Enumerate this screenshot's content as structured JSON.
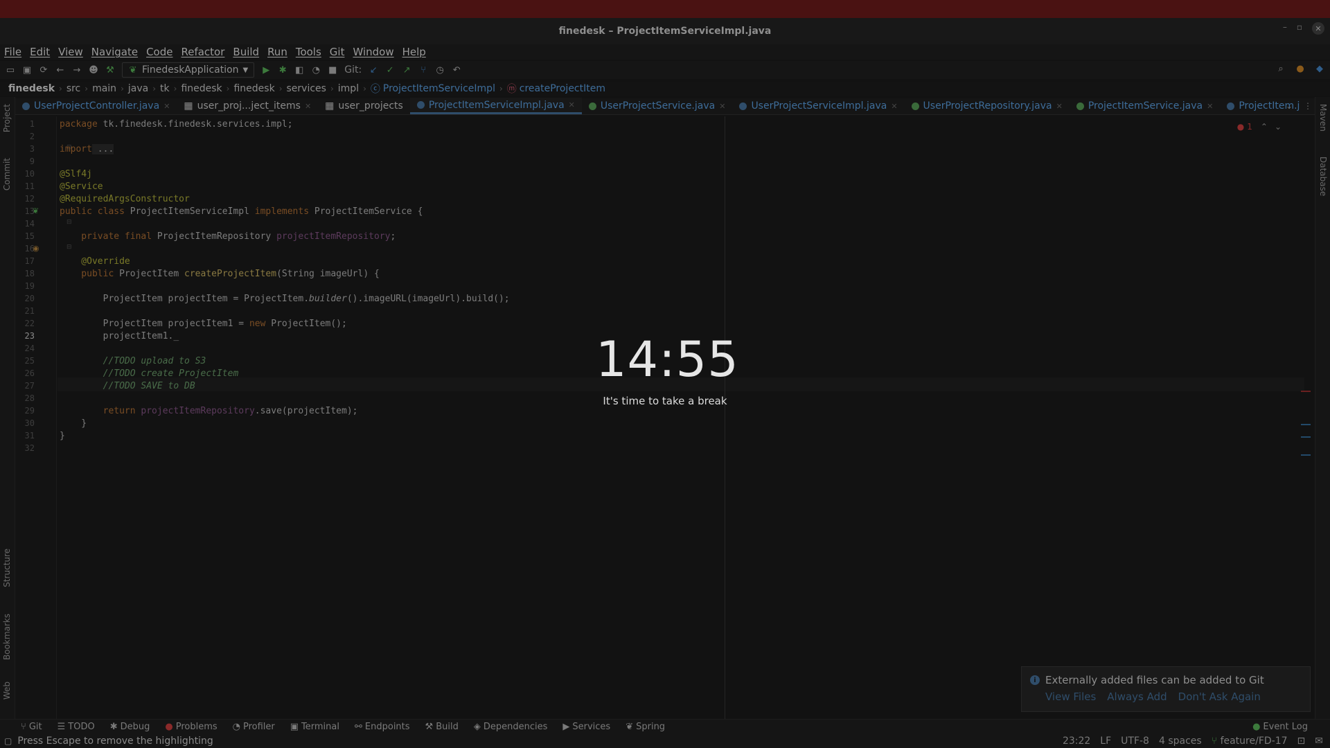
{
  "window": {
    "title": "finedesk – ProjectItemServiceImpl.java"
  },
  "menu": [
    "File",
    "Edit",
    "View",
    "Navigate",
    "Code",
    "Refactor",
    "Build",
    "Run",
    "Tools",
    "Git",
    "Window",
    "Help"
  ],
  "toolbar": {
    "run_config": "FinedeskApplication",
    "git_label": "Git:"
  },
  "breadcrumb": {
    "root": "finedesk",
    "items": [
      "src",
      "main",
      "java",
      "tk",
      "finedesk",
      "finedesk",
      "services",
      "impl"
    ],
    "class": "ProjectItemServiceImpl",
    "method": "createProjectItem"
  },
  "tabs": [
    {
      "label": "UserProjectController.java",
      "kind": "class"
    },
    {
      "label": "user_proj...ject_items",
      "kind": "table"
    },
    {
      "label": "user_projects",
      "kind": "table"
    },
    {
      "label": "ProjectItemServiceImpl.java",
      "kind": "class",
      "active": true
    },
    {
      "label": "UserProjectService.java",
      "kind": "interface"
    },
    {
      "label": "UserProjectServiceImpl.java",
      "kind": "class"
    },
    {
      "label": "UserProjectRepository.java",
      "kind": "interface"
    },
    {
      "label": "ProjectItemService.java",
      "kind": "interface"
    },
    {
      "label": "ProjectItem.j",
      "kind": "class"
    }
  ],
  "side_tools": {
    "left": [
      "Project",
      "Commit",
      "Structure",
      "Bookmarks",
      "Web"
    ],
    "right": [
      "Maven",
      "Database"
    ]
  },
  "editor": {
    "error_count": "1",
    "line_numbers": [
      "1",
      "2",
      "3",
      "9",
      "10",
      "11",
      "12",
      "13",
      "14",
      "15",
      "16",
      "17",
      "18",
      "19",
      "20",
      "21",
      "22",
      "23",
      "24",
      "25",
      "26",
      "27",
      "28",
      "29",
      "30",
      "31",
      "32"
    ],
    "current_line": "23",
    "lines": {
      "l1a": "package",
      "l1b": " tk.finedesk.finedesk.services.impl;",
      "l3a": "import",
      "l3b": " ...",
      "l10": "@Slf4j",
      "l11": "@Service",
      "l12": "@RequiredArgsConstructor",
      "l13a": "public class",
      "l13b": " ProjectItemServiceImpl ",
      "l13c": "implements",
      "l13d": " ProjectItemService {",
      "l15a": "    private final",
      "l15b": " ProjectItemRepository ",
      "l15c": "projectItemRepository",
      "l15d": ";",
      "l17": "    @Override",
      "l18a": "    public",
      "l18b": " ProjectItem ",
      "l18c": "createProjectItem",
      "l18d": "(String imageUrl) {",
      "l20a": "        ProjectItem projectItem = ProjectItem.",
      "l20b": "builder",
      "l20c": "().imageURL(imageUrl).build();",
      "l22a": "        ProjectItem projectItem1 = ",
      "l22b": "new",
      "l22c": " ProjectItem();",
      "l23": "        projectItem1._",
      "l25": "        //TODO upload to S3",
      "l26": "        //TODO create ProjectItem",
      "l27": "        //TODO SAVE to DB",
      "l29a": "        return",
      "l29b": " projectItemRepository",
      "l29c": ".save(projectItem);",
      "l30": "    }",
      "l31": "}"
    }
  },
  "break_overlay": {
    "time": "14:55",
    "message": "It's time to take a break"
  },
  "notification": {
    "message": "Externally added files can be added to Git",
    "actions": [
      "View Files",
      "Always Add",
      "Don't Ask Again"
    ]
  },
  "bottom_tools": [
    "Git",
    "TODO",
    "Debug",
    "Problems",
    "Profiler",
    "Terminal",
    "Endpoints",
    "Build",
    "Dependencies",
    "Services",
    "Spring"
  ],
  "event_log": "Event Log",
  "status": {
    "message": "Press Escape to remove the highlighting",
    "position": "23:22",
    "line_sep": "LF",
    "encoding": "UTF-8",
    "indent": "4 spaces",
    "branch": "feature/FD-17"
  }
}
